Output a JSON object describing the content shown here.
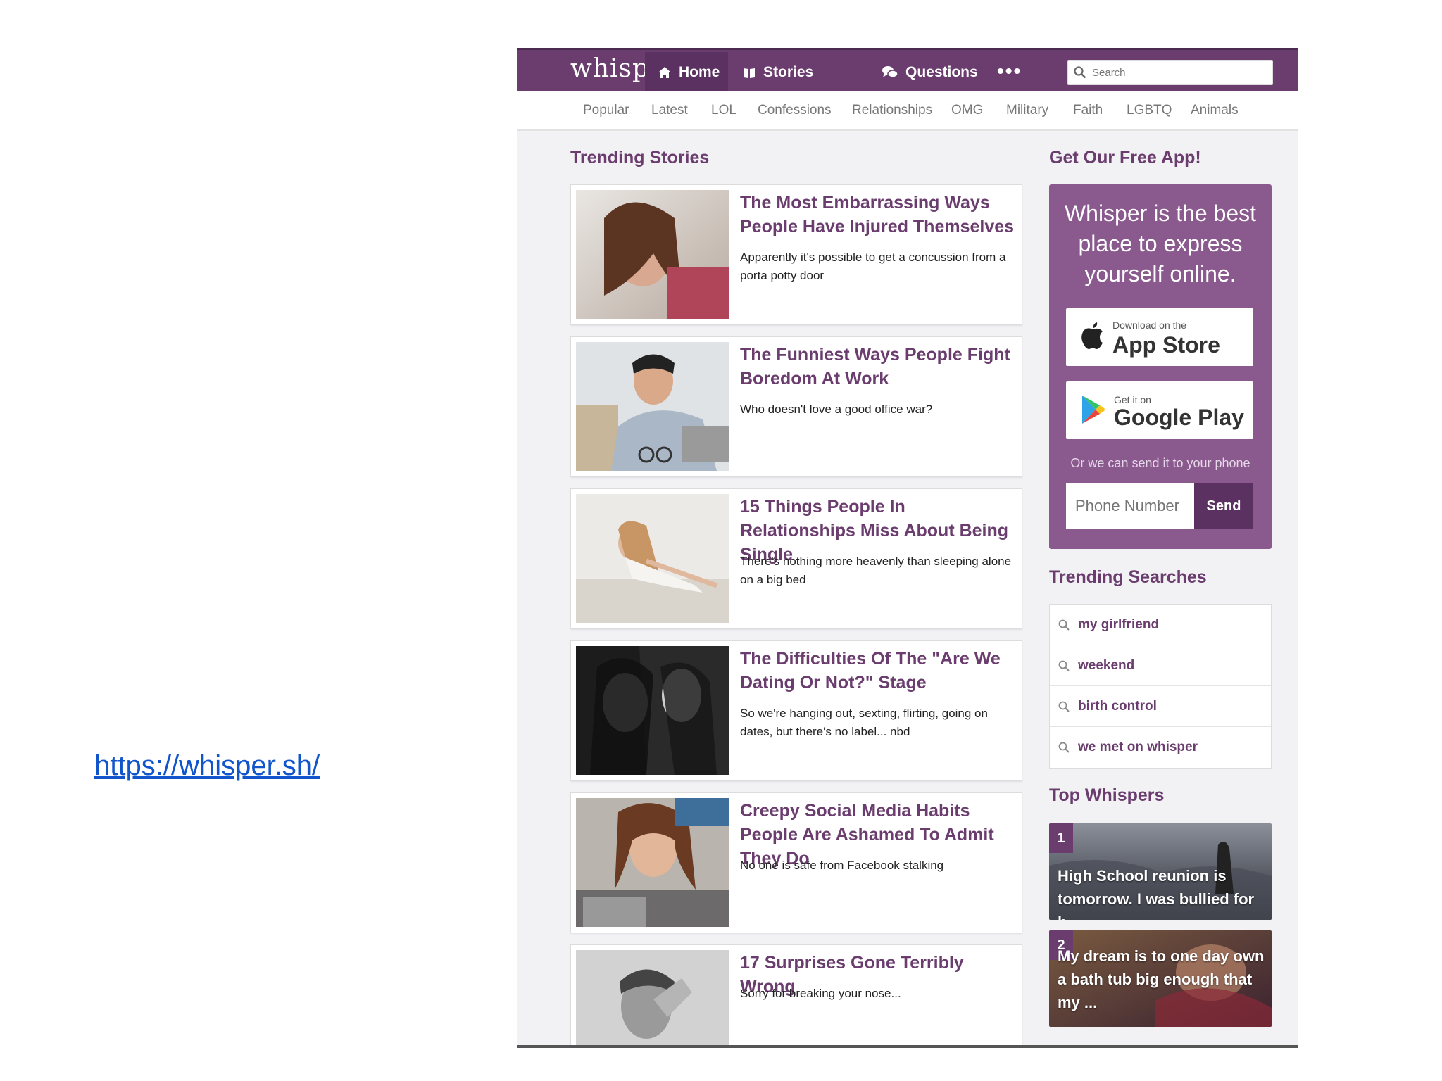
{
  "slide": {
    "link_text": "https://whisper.sh/"
  },
  "header": {
    "logo": "whisper",
    "nav": [
      {
        "label": "Home",
        "icon": "home-icon"
      },
      {
        "label": "Stories",
        "icon": "book-icon"
      },
      {
        "label": "Questions",
        "icon": "chat-bubbles-icon"
      }
    ],
    "more": "•••",
    "search_placeholder": "Search"
  },
  "categories": [
    "Popular",
    "Latest",
    "LOL",
    "Confessions",
    "Relationships",
    "OMG",
    "Military",
    "Faith",
    "LGBTQ",
    "Animals"
  ],
  "trending_stories": {
    "title": "Trending Stories",
    "items": [
      {
        "title": "The Most Embarrassing Ways People Have Injured Themselves",
        "desc": "Apparently it's possible to get a concussion from a porta potty door"
      },
      {
        "title": "The Funniest Ways People Fight Boredom At Work",
        "desc": "Who doesn't love a good office war?"
      },
      {
        "title": "15 Things People In Relationships Miss About Being Single",
        "desc": "There's nothing more heavenly than sleeping alone on a big bed"
      },
      {
        "title": "The Difficulties Of The \"Are We Dating Or Not?\" Stage",
        "desc": "So we're hanging out, sexting, flirting, going on dates, but there's no label... nbd"
      },
      {
        "title": "Creepy Social Media Habits People Are Ashamed To Admit They Do",
        "desc": "No one is safe from Facebook stalking"
      },
      {
        "title": "17 Surprises Gone Terribly Wrong",
        "desc": "Sorry for breaking your nose..."
      }
    ]
  },
  "app_promo": {
    "title": "Get Our Free App!",
    "headline": "Whisper is the best place to express yourself online.",
    "app_store_small": "Download on the",
    "app_store_big": "App Store",
    "google_small": "Get it on",
    "google_big": "Google Play",
    "or_text": "Or we can send it to your phone",
    "phone_placeholder": "Phone Number",
    "send_label": "Send"
  },
  "trending_searches": {
    "title": "Trending Searches",
    "items": [
      "my girlfriend",
      "weekend",
      "birth control",
      "we met on whisper"
    ]
  },
  "top_whispers": {
    "title": "Top Whispers",
    "items": [
      {
        "num": "1",
        "text": "High School reunion is tomorrow. I was bullied for b..."
      },
      {
        "num": "2",
        "text": "My dream is to one day own a bath tub big enough that my ..."
      }
    ]
  },
  "colors": {
    "brand": "#6a3d6e",
    "brand_dark": "#5a3160",
    "promo_bg": "#8a5a8e"
  }
}
